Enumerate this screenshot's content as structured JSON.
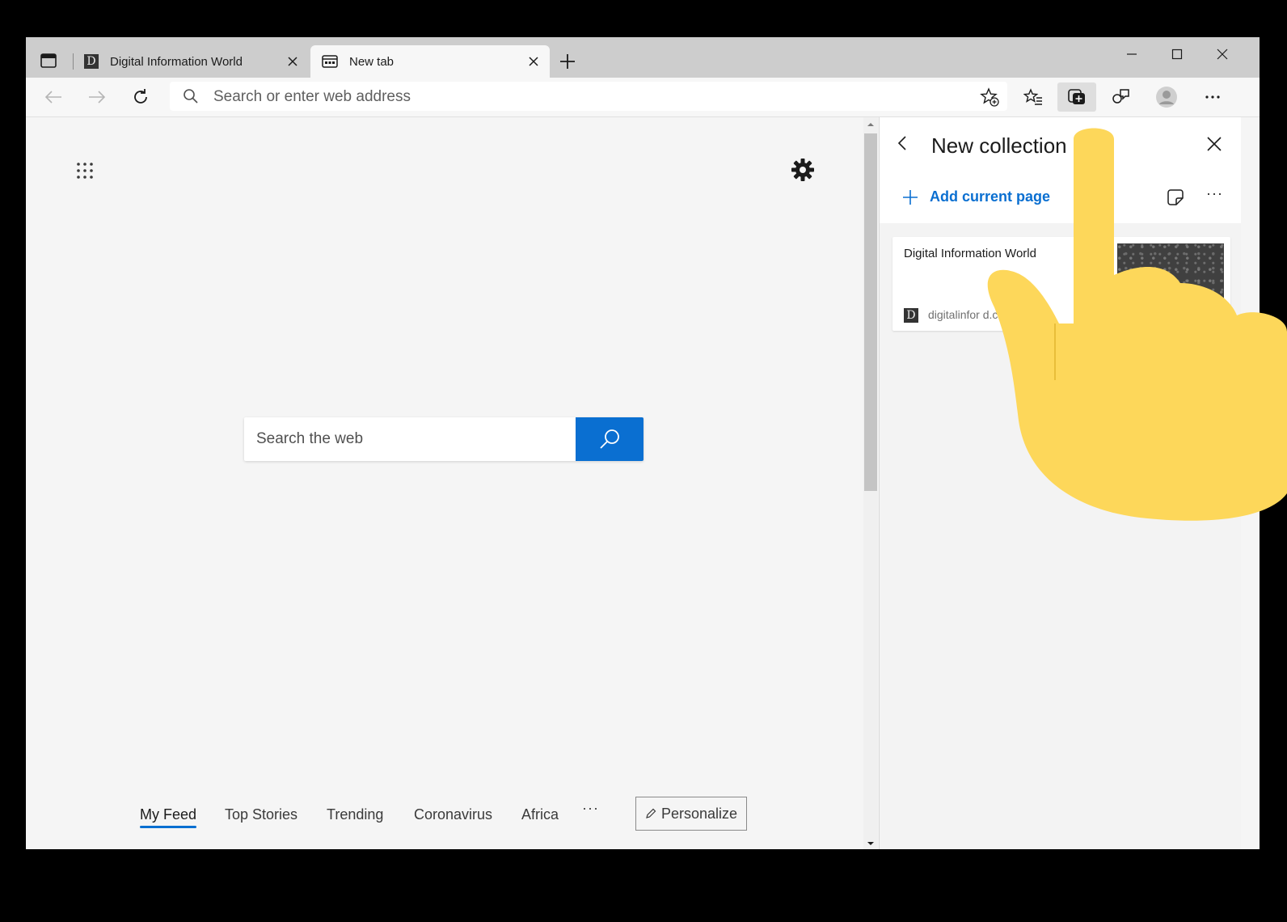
{
  "tabs": [
    {
      "label": "Digital Information World",
      "favicon": "D",
      "active": false
    },
    {
      "label": "New tab",
      "active": true
    }
  ],
  "toolbar": {
    "address_placeholder": "Search or enter web address"
  },
  "page": {
    "search_placeholder": "Search the web",
    "feed_tabs": [
      "My Feed",
      "Top Stories",
      "Trending",
      "Coronavirus",
      "Africa"
    ],
    "feed_more": "···",
    "personalize_label": "Personalize"
  },
  "collections_pane": {
    "title": "New collection",
    "add_current_page": "Add current page",
    "more": "···",
    "items": [
      {
        "title": "Digital Information World",
        "favicon": "D",
        "url": "digitalinfor               d.c"
      }
    ]
  },
  "colors": {
    "accent": "#0a6fd1",
    "hand": "#fdd75a",
    "tabstrip": "#cdcdcd"
  },
  "icons": [
    "tab-actions-icon",
    "close-icon",
    "plus-icon",
    "minimize-icon",
    "maximize-icon",
    "back-arrow-icon",
    "forward-arrow-icon",
    "refresh-icon",
    "search-icon",
    "add-favorite-icon",
    "favorites-icon",
    "collections-icon",
    "feedback-icon",
    "profile-icon",
    "more-icon",
    "apps-grid-icon",
    "gear-icon",
    "pencil-icon",
    "note-icon",
    "pointing-hand-icon"
  ]
}
